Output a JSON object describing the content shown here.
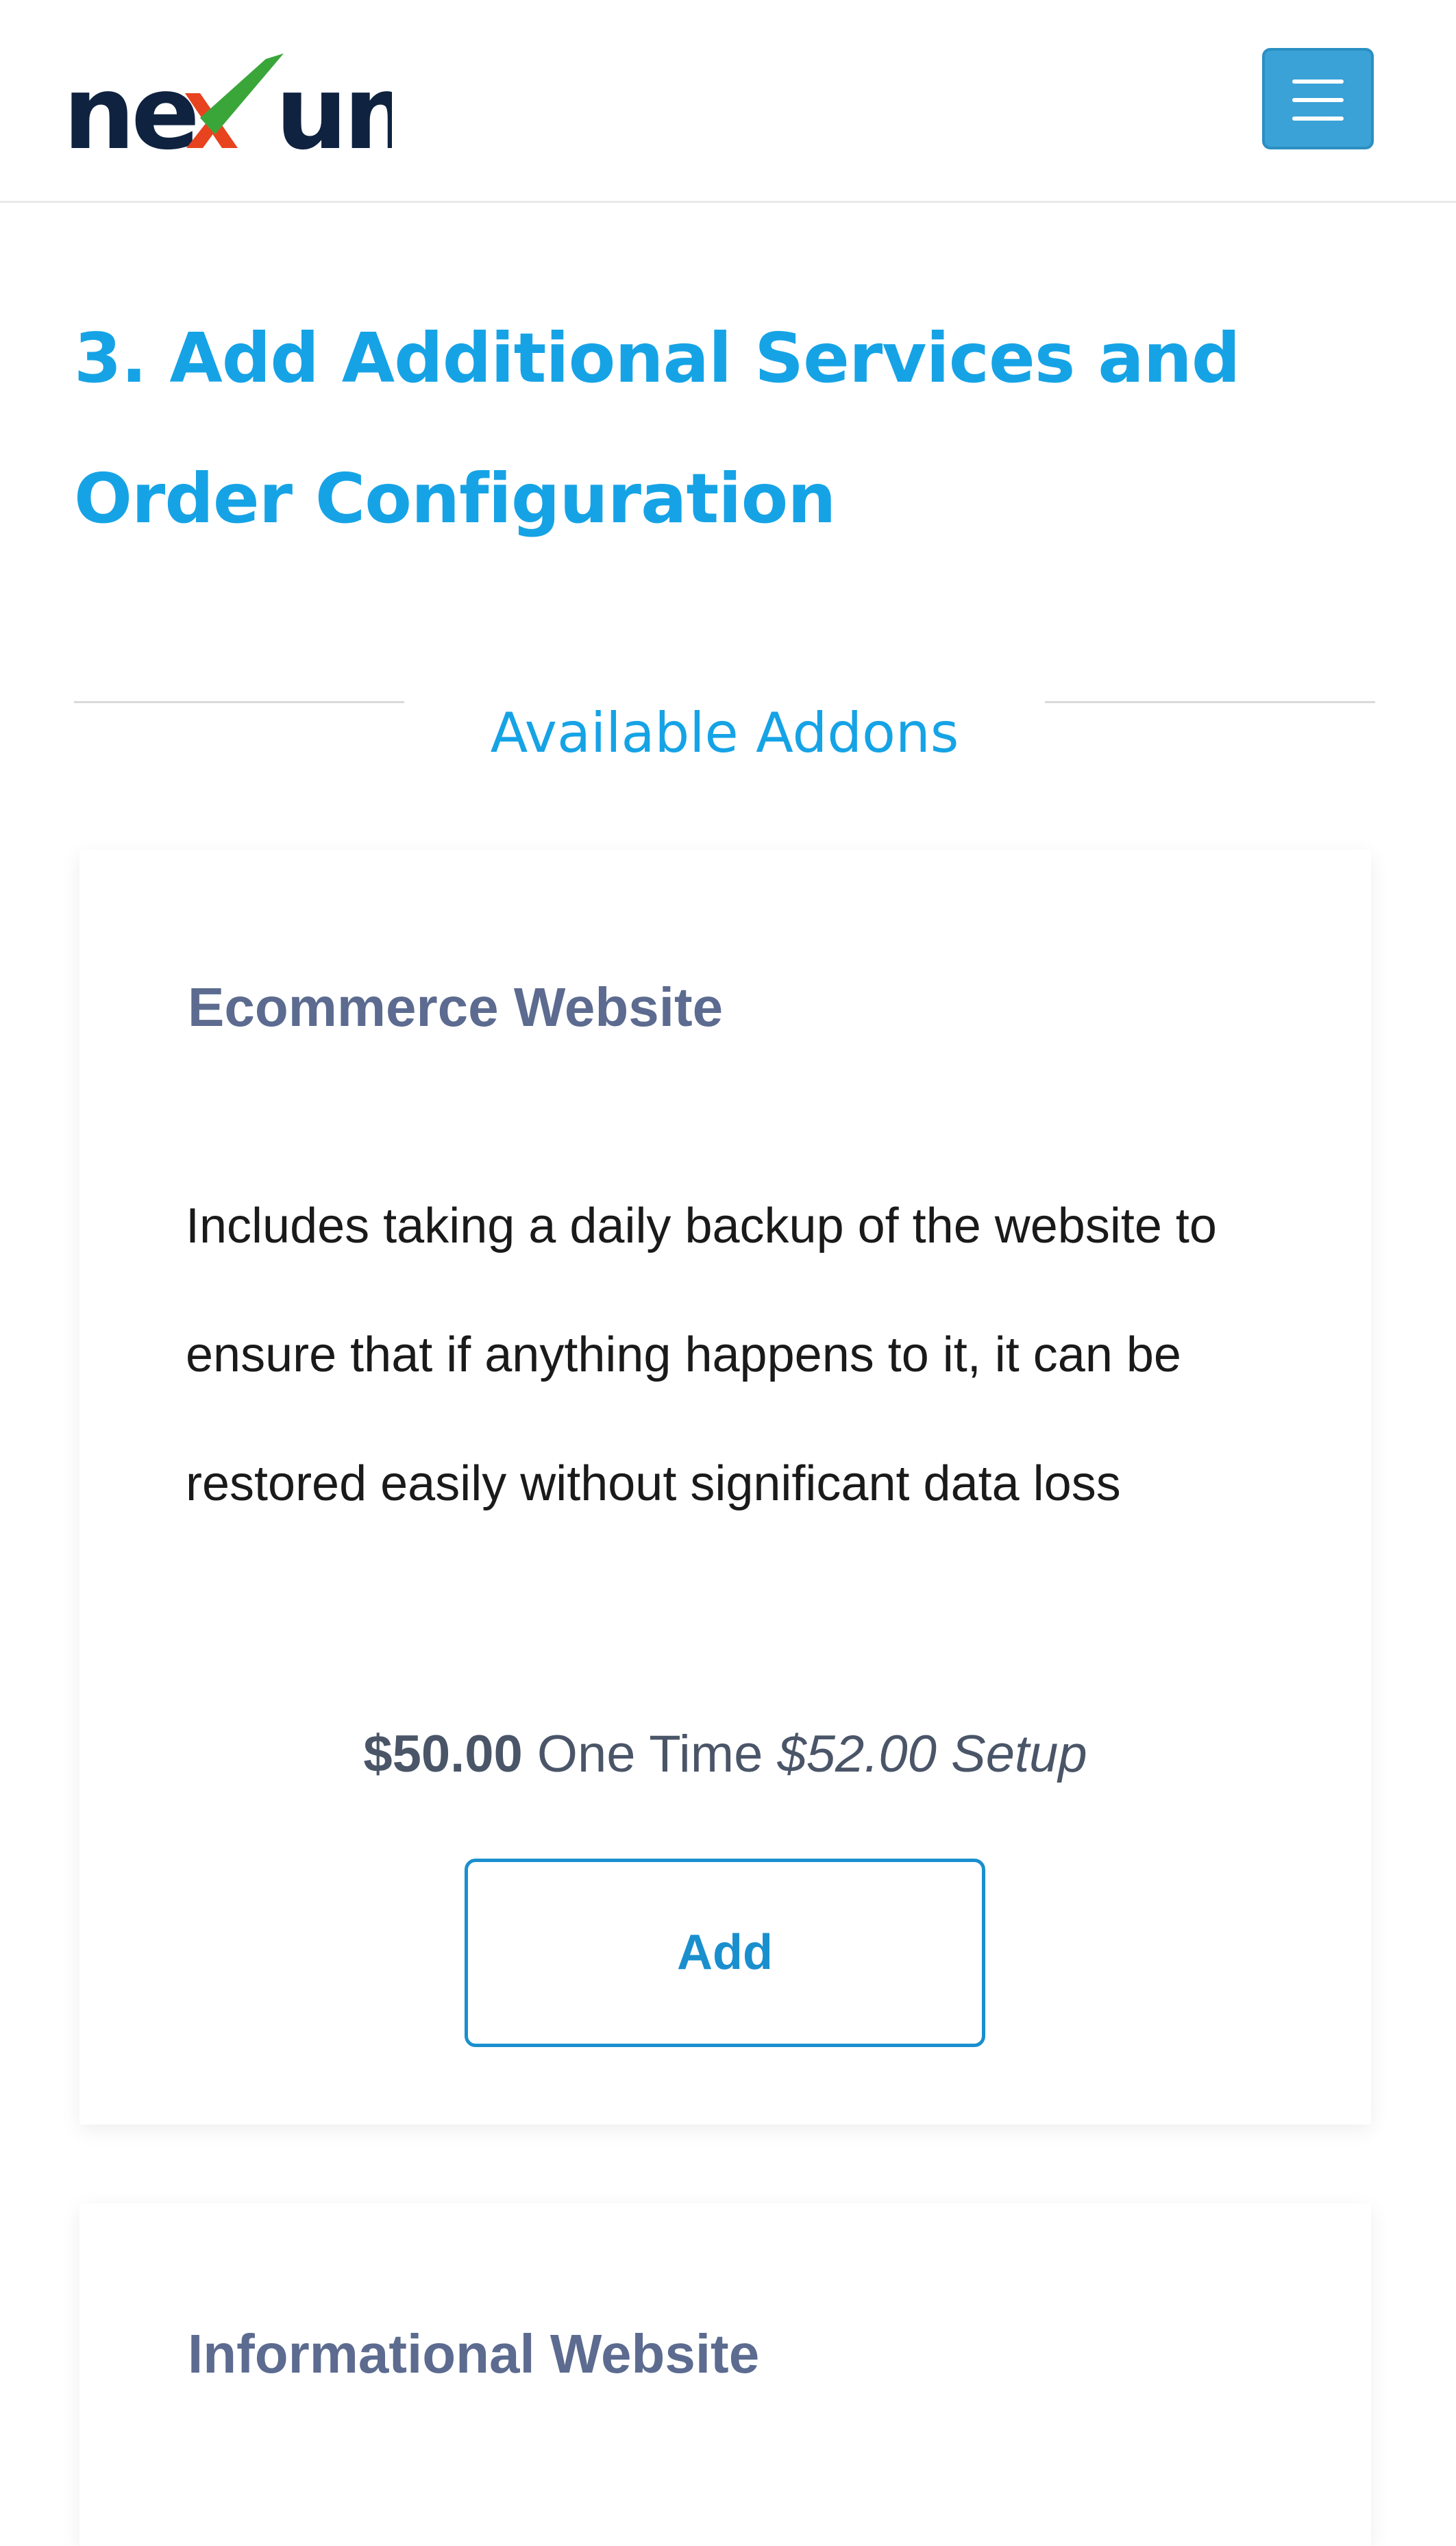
{
  "header": {
    "logo_text": "nexum",
    "brand_colors": {
      "navy": "#0f2240",
      "red": "#e8431f",
      "green": "#3aa63a"
    },
    "menu_icon": "hamburger-menu-icon",
    "menu_color": "#3aa2d6"
  },
  "section": {
    "title": "3. Add Additional Services and Order Configuration",
    "accent_color": "#16a3e6"
  },
  "addons": {
    "heading": "Available Addons",
    "items": [
      {
        "name": "Ecommerce Website",
        "description": "Includes taking a daily backup of the website to ensure that if anything happens to it, it can be restored easily without significant data loss",
        "price_amount": "$50.00",
        "price_term": "One Time",
        "setup_fee": "$52.00 Setup",
        "button_label": "Add"
      },
      {
        "name": "Informational Website"
      }
    ]
  }
}
